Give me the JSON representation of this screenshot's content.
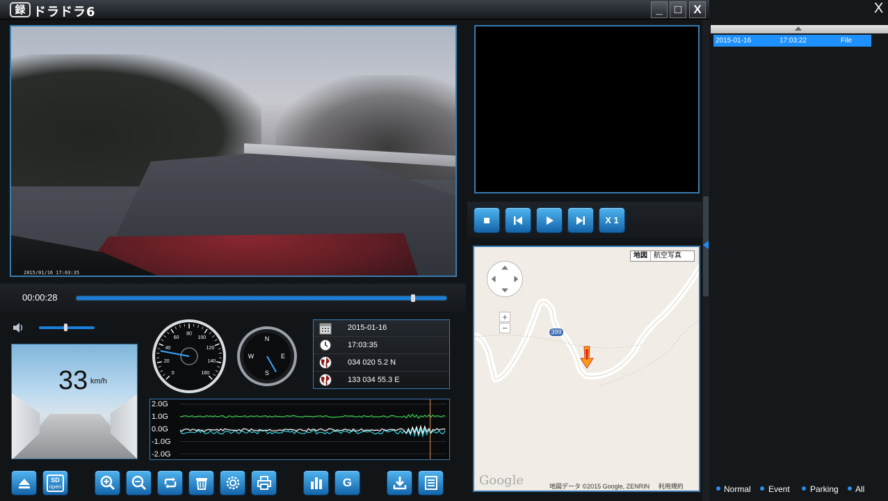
{
  "window": {
    "logo_text": "録",
    "title": "ドラドラ6",
    "minimize_label": "_",
    "maximize_label": "□",
    "close_label": "X"
  },
  "video": {
    "caption": "2015/01/16  17:03:35",
    "progress_fraction": 0.91
  },
  "seek": {
    "elapsed": "00:00:28"
  },
  "volume": {
    "level_fraction": 0.47
  },
  "speed": {
    "value": "33",
    "unit": "km/h"
  },
  "speedometer": {
    "ticks": [
      "0",
      "20",
      "40",
      "60",
      "80",
      "100",
      "120",
      "140",
      "160"
    ],
    "value": 33
  },
  "compass": {
    "n": "N",
    "e": "E",
    "s": "S",
    "w": "W",
    "heading_deg": 150
  },
  "info": {
    "date": "2015-01-16",
    "time": "17:03:35",
    "latitude": "034 020 5.2 N",
    "longitude": "133 034 55.3 E"
  },
  "gsensor": {
    "labels": [
      "2.0G",
      "1.0G",
      "0.0G",
      "-1.0G",
      "-2.0G"
    ],
    "colors": {
      "x": "#39d04a",
      "y": "#ffffff",
      "z": "#35d8e0",
      "cursor": "#e8a05a"
    }
  },
  "toolbar": {
    "sd_label": "SD",
    "sd_sub": "open",
    "g_label": "G"
  },
  "playback": {
    "speed_label": "X 1"
  },
  "map": {
    "type_map": "地図",
    "type_satellite": "航空写真",
    "zoom_in": "+",
    "zoom_out": "−",
    "road_number": "399",
    "google": "Google",
    "credit": "地図データ ©2015 Google, ZENRIN",
    "terms": "利用規約"
  },
  "filelist": {
    "close_label": "X",
    "rows": [
      {
        "date": "2015-01-16",
        "time": "17:03:22",
        "type": "File"
      }
    ],
    "filters": [
      "Normal",
      "Event",
      "Parking",
      "All"
    ]
  }
}
